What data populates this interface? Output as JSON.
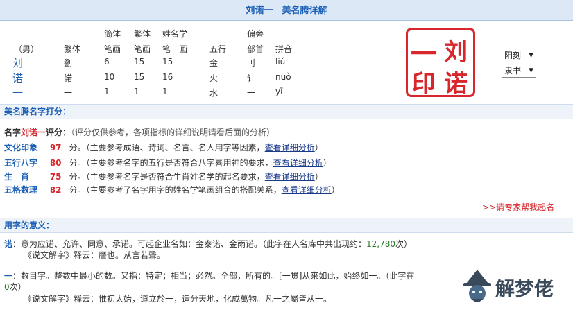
{
  "title": "刘诺一　美名腾详解",
  "table": {
    "gender": "（男）",
    "headers": {
      "fanti": "繁体",
      "jianti_top": "简体",
      "jianti_bottom": "笔画",
      "fanti2_top": "繁体",
      "fanti2_bottom": "笔画",
      "xingming_top": "姓名学",
      "xingming_bottom": "笔　画",
      "wuxing": "五行",
      "pianpang_top": "偏旁",
      "pianpang_bottom": "部首",
      "pinyin": "拼音"
    },
    "rows": [
      {
        "char": "刘",
        "fanti": "劉",
        "jianti": "6",
        "fantibh": "15",
        "xmbh": "15",
        "wuxing": "金",
        "bushou": "刂",
        "pinyin": "liú"
      },
      {
        "char": "诺",
        "fanti": "諾",
        "jianti": "10",
        "fantibh": "15",
        "xmbh": "16",
        "wuxing": "火",
        "bushou": "讠",
        "pinyin": "nuò"
      },
      {
        "char": "一",
        "fanti": "一",
        "jianti": "1",
        "fantibh": "1",
        "xmbh": "1",
        "wuxing": "水",
        "bushou": "一",
        "pinyin": "yī"
      }
    ]
  },
  "seal": {
    "chars": [
      "刘",
      "诺",
      "一",
      "印"
    ],
    "color": "#d7262c",
    "select1": "阳刻",
    "select2": "隶书"
  },
  "score_section": {
    "heading": "美名腾名字打分：",
    "intro_prefix": "名字",
    "intro_name": "刘诺一",
    "intro_suffix": "评分：",
    "intro_note": "（评分仅供参考，各项指标的详细说明请看后面的分析）",
    "items": [
      {
        "label": "文化印象",
        "score": "97",
        "unit": "分。",
        "desc": "（主要参考成语、诗词、名言、名人用字等因素，",
        "link": "查看详细分析",
        "end": "）"
      },
      {
        "label": "五行八字",
        "score": "80",
        "unit": "分。",
        "desc": "（主要参考名字的五行是否符合八字喜用神的要求，",
        "link": "查看详细分析",
        "end": "）"
      },
      {
        "label": "生　肖",
        "score": "75",
        "unit": "分。",
        "desc": "（主要参考名字是否符合生肖姓名学的起名要求，",
        "link": "查看详细分析",
        "end": "）"
      },
      {
        "label": "五格数理",
        "score": "82",
        "unit": "分。",
        "desc": "（主要参考了名字用字的姓名学笔画组合的搭配关系，",
        "link": "查看详细分析",
        "end": "）"
      }
    ],
    "expert_link": ">>请专家帮我起名"
  },
  "meaning_section": {
    "heading": "用字的意义：",
    "nuo_char": "诺",
    "nuo_text": "：意为应诺、允许、同意、承诺。可起企业名如：金泰诺、金雨诺。（此字在人名库中共出现约：",
    "nuo_count": "12,780",
    "nuo_end": "次）",
    "nuo_shuowen": "《说文解字》释云：",
    "nuo_shuowen_text": "譍也。从言若聲。",
    "yi_char": "一",
    "yi_text": "：数目字。整数中最小的数。又指：特定；相当；必然。全部，所有的。[一贯]从来如此，始终如一。（此字在",
    "yi_count": "0",
    "yi_end": "次）",
    "yi_shuowen": "《说文解字》释云：",
    "yi_shuowen_text": "惟初太始，道立於一，造分天地，化成萬物。凡一之屬皆从一。"
  },
  "watermark": "解梦佬"
}
